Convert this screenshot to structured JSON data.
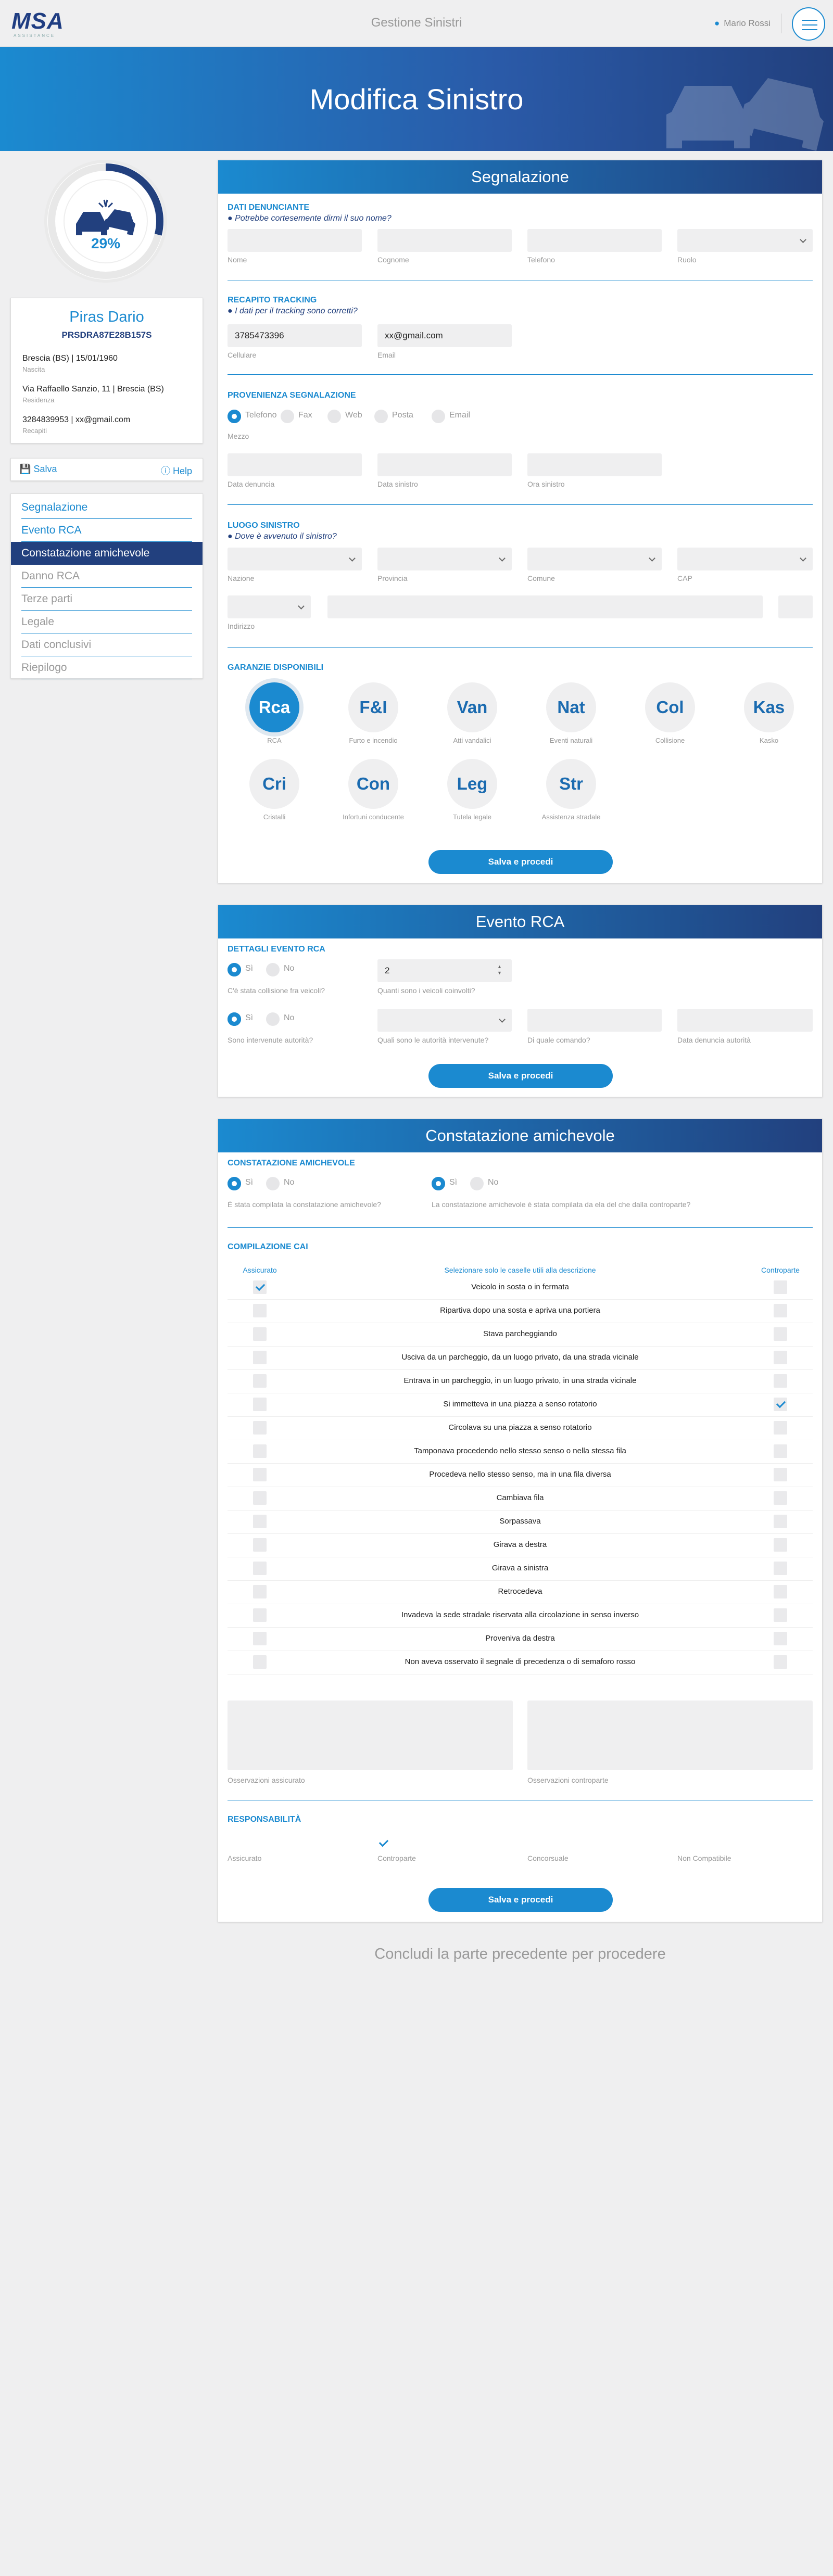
{
  "header": {
    "logo": "MSA",
    "logo_sub": "ASSISTANCE",
    "title": "Gestione Sinistri",
    "user": "Mario Rossi"
  },
  "banner": {
    "title": "Modifica Sinistro"
  },
  "progress": {
    "percent": 29,
    "label": "29%"
  },
  "customer": {
    "name": "Piras Dario",
    "cf": "PRSDRA87E28B157S",
    "birth": "Brescia (BS) | 15/01/1960",
    "birth_label": "Nascita",
    "residence": "Via Raffaello Sanzio, 11 | Brescia (BS)",
    "residence_label": "Residenza",
    "contact": "3284839953 | xx@gmail.com",
    "contact_label": "Recapiti"
  },
  "actions": {
    "save": "Salva",
    "help": "Help"
  },
  "nav": [
    {
      "label": "Segnalazione",
      "state": "link"
    },
    {
      "label": "Evento RCA",
      "state": "link"
    },
    {
      "label": "Constatazione amichevole",
      "state": "active"
    },
    {
      "label": "Danno RCA",
      "state": "disabled"
    },
    {
      "label": "Terze parti",
      "state": "disabled"
    },
    {
      "label": "Legale",
      "state": "disabled"
    },
    {
      "label": "Dati conclusivi",
      "state": "disabled"
    },
    {
      "label": "Riepilogo",
      "state": "disabled"
    }
  ],
  "segnalazione": {
    "title": "Segnalazione",
    "denunciante": {
      "title": "DATI DENUNCIANTE",
      "hint": "Potrebbe cortesemente dirmi il suo nome?",
      "labels": [
        "Nome",
        "Cognome",
        "Telefono",
        "Ruolo"
      ]
    },
    "tracking": {
      "title": "RECAPITO TRACKING",
      "hint": "I dati per il tracking sono corretti?",
      "cell_value": "3785473396",
      "email_value": "xx@gmail.com",
      "cell_label": "Cellulare",
      "email_label": "Email"
    },
    "provenienza": {
      "title": "PROVENIENZA SEGNALAZIONE",
      "options": [
        "Telefono",
        "Fax",
        "Web",
        "Posta",
        "Email"
      ],
      "selected": "Telefono",
      "mezzo_label": "Mezzo",
      "labels": [
        "Data denuncia",
        "Data sinistro",
        "Ora sinistro"
      ]
    },
    "luogo": {
      "title": "LUOGO SINISTRO",
      "hint": "Dove è avvenuto il sinistro?",
      "labels": [
        "Nazione",
        "Provincia",
        "Comune",
        "CAP"
      ],
      "indirizzo_label": "Indirizzo"
    },
    "garanzie": {
      "title": "GARANZIE DISPONIBILI",
      "items": [
        {
          "code": "Rca",
          "label": "RCA",
          "on": true
        },
        {
          "code": "F&I",
          "label": "Furto e incendio",
          "on": false
        },
        {
          "code": "Van",
          "label": "Atti vandalici",
          "on": false
        },
        {
          "code": "Nat",
          "label": "Eventi naturali",
          "on": false
        },
        {
          "code": "Col",
          "label": "Collisione",
          "on": false
        },
        {
          "code": "Kas",
          "label": "Kasko",
          "on": false
        },
        {
          "code": "Cri",
          "label": "Cristalli",
          "on": false
        },
        {
          "code": "Con",
          "label": "Infortuni conducente",
          "on": false
        },
        {
          "code": "Leg",
          "label": "Tutela legale",
          "on": false
        },
        {
          "code": "Str",
          "label": "Assistenza stradale",
          "on": false
        }
      ]
    },
    "button": "Salva e procedi"
  },
  "evento": {
    "title": "Evento RCA",
    "section": "DETTAGLI EVENTO RCA",
    "yes": "Sì",
    "no": "No",
    "q1": "C'è stata collisione fra veicoli?",
    "q2": "Quanti sono i veicoli coinvolti?",
    "vehicles": "2",
    "q3": "Sono intervenute autorità?",
    "q4": "Quali sono le autorità intervenute?",
    "q5": "Di quale comando?",
    "q6": "Data denuncia autorità",
    "button": "Salva e procedi"
  },
  "constatazione": {
    "title": "Constatazione amichevole",
    "section": "CONSTATAZIONE AMICHEVOLE",
    "yes": "Sì",
    "no": "No",
    "q1": "È stata compilata la constatazione amichevole?",
    "q2": "La constatazione amichevole è stata compilata da ela del che dalla controparte?",
    "cai_title": "COMPILAZIONE CAI",
    "col_left": "Assicurato",
    "col_mid": "Selezionare solo le caselle utili alla descrizione",
    "col_right": "Controparte",
    "rows": [
      {
        "text": "Veicolo in sosta o in fermata",
        "a": true,
        "c": false
      },
      {
        "text": "Ripartiva dopo una sosta e apriva una portiera",
        "a": false,
        "c": false
      },
      {
        "text": "Stava parcheggiando",
        "a": false,
        "c": false
      },
      {
        "text": "Usciva da un parcheggio, da un luogo privato, da una strada vicinale",
        "a": false,
        "c": false
      },
      {
        "text": "Entrava in un parcheggio, in un luogo privato, in una strada vicinale",
        "a": false,
        "c": false
      },
      {
        "text": "Si immetteva in una piazza a senso rotatorio",
        "a": false,
        "c": true
      },
      {
        "text": "Circolava su una piazza a senso rotatorio",
        "a": false,
        "c": false
      },
      {
        "text": "Tamponava procedendo nello stesso senso o nella stessa fila",
        "a": false,
        "c": false
      },
      {
        "text": "Procedeva nello stesso senso, ma in una fila diversa",
        "a": false,
        "c": false
      },
      {
        "text": "Cambiava fila",
        "a": false,
        "c": false
      },
      {
        "text": "Sorpassava",
        "a": false,
        "c": false
      },
      {
        "text": "Girava a destra",
        "a": false,
        "c": false
      },
      {
        "text": "Girava a sinistra",
        "a": false,
        "c": false
      },
      {
        "text": "Retrocedeva",
        "a": false,
        "c": false
      },
      {
        "text": "Invadeva la sede stradale riservata alla circolazione in senso inverso",
        "a": false,
        "c": false
      },
      {
        "text": "Proveniva da destra",
        "a": false,
        "c": false
      },
      {
        "text": "Non aveva osservato il segnale di precedenza o di semaforo rosso",
        "a": false,
        "c": false
      }
    ],
    "obs_left": "Osservazioni assicurato",
    "obs_right": "Osservazioni controparte",
    "resp_title": "RESPONSABILITÀ",
    "resp": [
      "Assicurato",
      "Controparte",
      "Concorsuale",
      "Non Compatibile"
    ],
    "resp_selected": "Controparte",
    "button": "Salva e procedi"
  },
  "footer_msg": "Concludi la parte precedente per procedere"
}
